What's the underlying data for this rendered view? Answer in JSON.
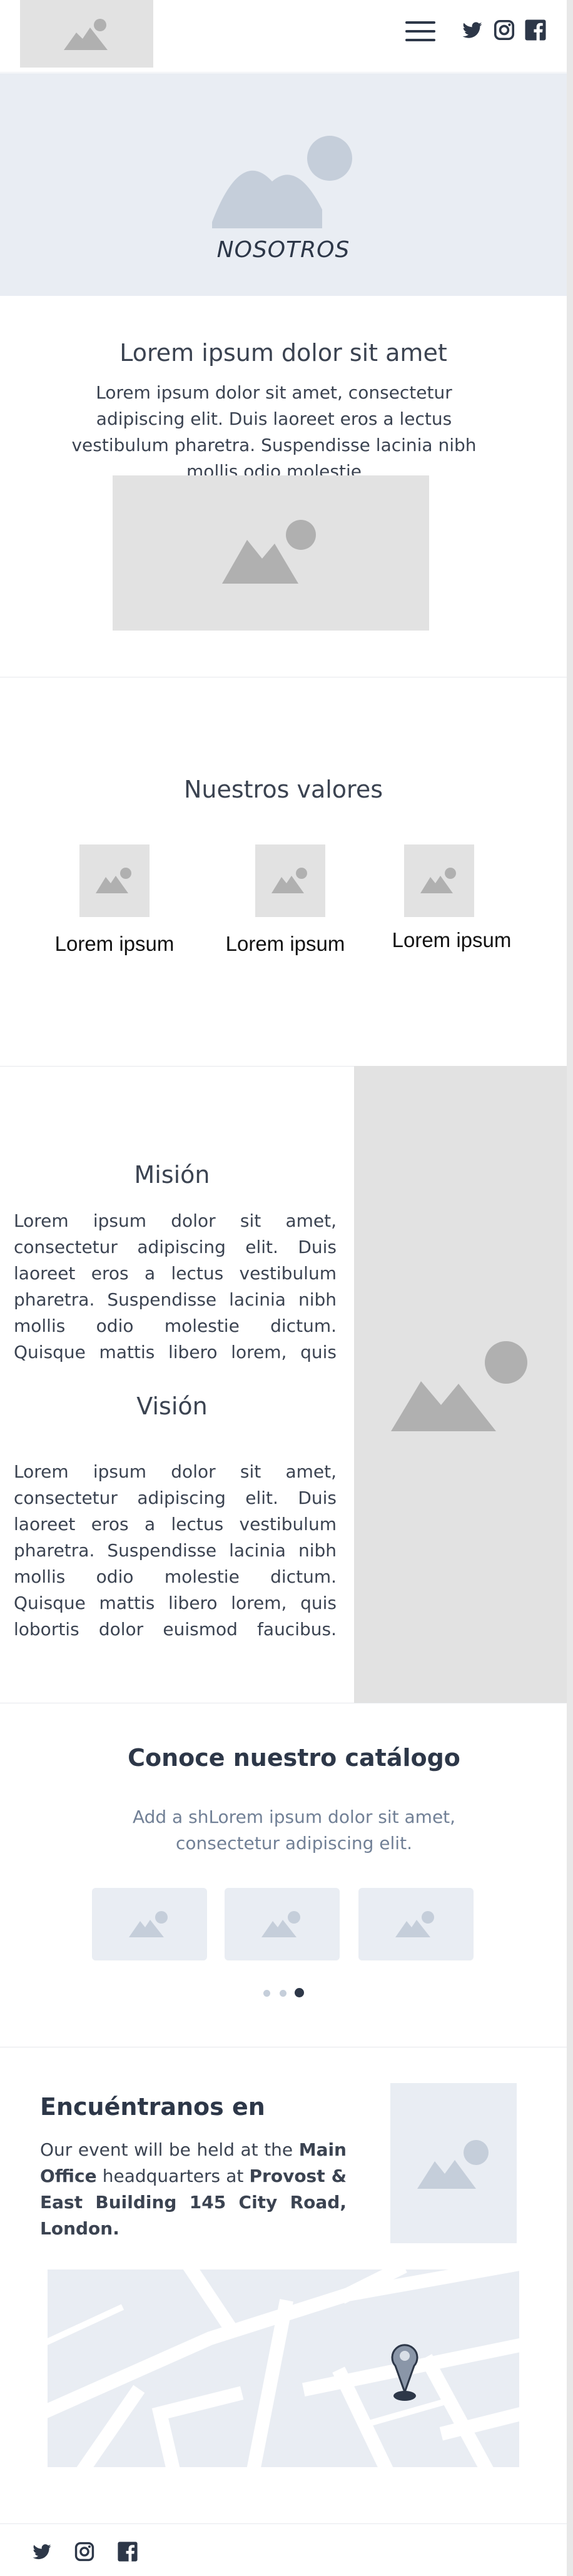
{
  "header": {
    "logo_icon": "image-placeholder-icon",
    "menu_icon": "hamburger-icon",
    "social": [
      "twitter-icon",
      "instagram-icon",
      "facebook-icon"
    ]
  },
  "hero": {
    "title": "NOSOTROS"
  },
  "intro": {
    "heading": "Lorem ipsum dolor sit amet",
    "text": "Lorem ipsum dolor sit amet, consectetur adipiscing elit. Duis laoreet eros a lectus vestibulum pharetra. Suspendisse lacinia nibh mollis odio molestie"
  },
  "values": {
    "heading": "Nuestros valores",
    "items": [
      {
        "label": "Lorem ipsum"
      },
      {
        "label": "Lorem ipsum"
      },
      {
        "label": "Lorem ipsum"
      }
    ]
  },
  "mission": {
    "heading": "Misión",
    "text": "Lorem ipsum dolor sit amet, consectetur adipiscing elit. Duis laoreet eros a lectus vestibulum pharetra. Suspendisse lacinia nibh mollis odio molestie dictum. Quisque mattis libero lorem, quis lobortis dolor euismod"
  },
  "vision": {
    "heading": "Visión",
    "text": "Lorem ipsum dolor sit amet, consectetur adipiscing elit. Duis laoreet eros a lectus vestibulum pharetra. Suspendisse lacinia nibh mollis odio molestie dictum. Quisque mattis libero lorem, quis lobortis dolor euismod faucibus. Integer consequat lacus eget"
  },
  "catalog": {
    "heading": "Conoce nuestro catálogo",
    "text": "Add a shLorem ipsum dolor sit amet, consectetur adipiscing elit.",
    "dots": 3,
    "active_dot": 3
  },
  "find": {
    "heading": "Encuéntranos en",
    "text_1": "Our event will be held at the ",
    "bold_1": "Main Office",
    "text_2": " headquarters at ",
    "bold_2": "Provost & East Building 145 City Road, London."
  },
  "footer": {
    "social": [
      "twitter-icon",
      "instagram-icon",
      "facebook-icon"
    ]
  },
  "colors": {
    "placeholder_gray": "#e2e2e2",
    "placeholder_blue": "#e9edf3",
    "icon_gray": "#b0b0b0",
    "icon_blue": "#c5ceda",
    "text_dark": "#2d3748",
    "text_muted": "#718096"
  }
}
